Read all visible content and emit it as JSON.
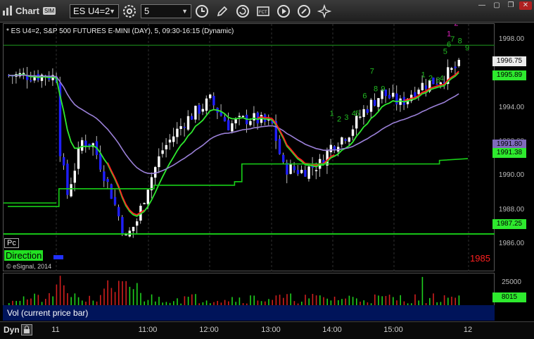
{
  "window": {
    "title": "Chart",
    "badge": "SIM",
    "symbol": "ES U4=2",
    "interval": "5"
  },
  "chart": {
    "description": "* ES U4=2, S&P 500 FUTURES E-MINI (DAY), 5, 09:30-16:15 (Dynamic)",
    "copyright": "© eSignal, 2014",
    "pc_label": "Pc",
    "direction_label": "Direction",
    "direction_value": "1985",
    "price_tags": {
      "last": "1996.75",
      "ma_fast": "1995.89",
      "ma_purple": "1991.80",
      "ma_green": "1991.38",
      "level": "1987.25"
    },
    "count_labels": [
      "1",
      "2",
      "3",
      "4",
      "5",
      "6",
      "7",
      "8",
      "9"
    ],
    "colors": {
      "up": "#ffffff",
      "down": "#1f1fff",
      "ma_green": "#2eea2e",
      "ma_red": "#ff2020",
      "ma_purple": "#9b80d8",
      "level": "#18d018",
      "dashed": "#ff2020",
      "count_green": "#22bb22",
      "count_magenta": "#e020c0"
    }
  },
  "yaxis": {
    "labels": [
      "1998.00",
      "1996.00",
      "1994.00",
      "1992.00",
      "1990.00",
      "1988.00",
      "1986.00"
    ]
  },
  "volume": {
    "label": "Vol (current price bar)",
    "yaxis": [
      "25000",
      "8015"
    ]
  },
  "xaxis": {
    "labels": [
      "11",
      "11:00",
      "12:00",
      "13:00",
      "14:00",
      "15:00",
      "12"
    ]
  },
  "footer": {
    "dyn": "Dyn"
  },
  "chart_data": {
    "type": "candlestick",
    "title": "* ES U4=2, S&P 500 FUTURES E-MINI (DAY), 5, 09:30-16:15 (Dynamic)",
    "ylim": [
      1985.1,
      1999.1
    ],
    "y_ticks": [
      1986,
      1988,
      1990,
      1992,
      1994,
      1996,
      1998
    ],
    "x_ticks": [
      "11",
      "11:00",
      "12:00",
      "13:00",
      "14:00",
      "15:00",
      "12"
    ],
    "level_1987_25": 1987.25,
    "dashed_level": 1985,
    "last": 1996.75,
    "series": [
      {
        "name": "ma_fast",
        "last": 1995.89
      },
      {
        "name": "ma_purple",
        "last": 1991.8
      },
      {
        "name": "ma_green",
        "last": 1991.38
      }
    ],
    "volume_ylim": [
      0,
      28000
    ],
    "volume_last": 8015
  }
}
